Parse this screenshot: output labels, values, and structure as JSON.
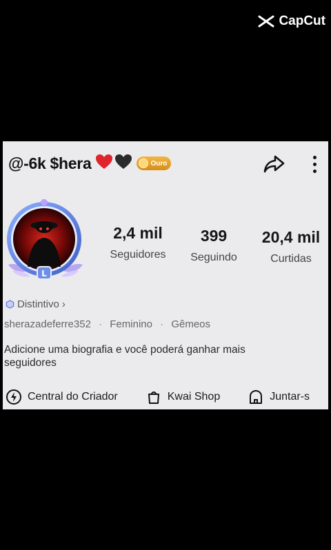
{
  "watermark": {
    "brand": "CapCut"
  },
  "profile": {
    "username": "@-6k $hera",
    "rank_badge": "Ouro",
    "stats": [
      {
        "value": "2,4 mil",
        "label": "Seguidores"
      },
      {
        "value": "399",
        "label": "Seguindo"
      },
      {
        "value": "20,4 mil",
        "label": "Curtidas"
      }
    ],
    "badge_link": "Distintivo",
    "handle": "sherazadeferre352",
    "gender": "Feminino",
    "zodiac": "Gêmeos",
    "bio": "Adicione uma biografia e você poderá ganhar mais seguidores"
  },
  "actions": [
    {
      "label": "Central do Criador",
      "icon": "lightning-circle-icon"
    },
    {
      "label": "Kwai Shop",
      "icon": "shopping-bag-icon"
    },
    {
      "label": "Juntar-s",
      "icon": "house-icon"
    }
  ],
  "colors": {
    "background": "#000000",
    "panel": "#ebebee",
    "gold": "#e0a02a",
    "heart_red": "#e0242b",
    "heart_black": "#2a2a2a",
    "avatar_ring": "#5a7bd6"
  }
}
